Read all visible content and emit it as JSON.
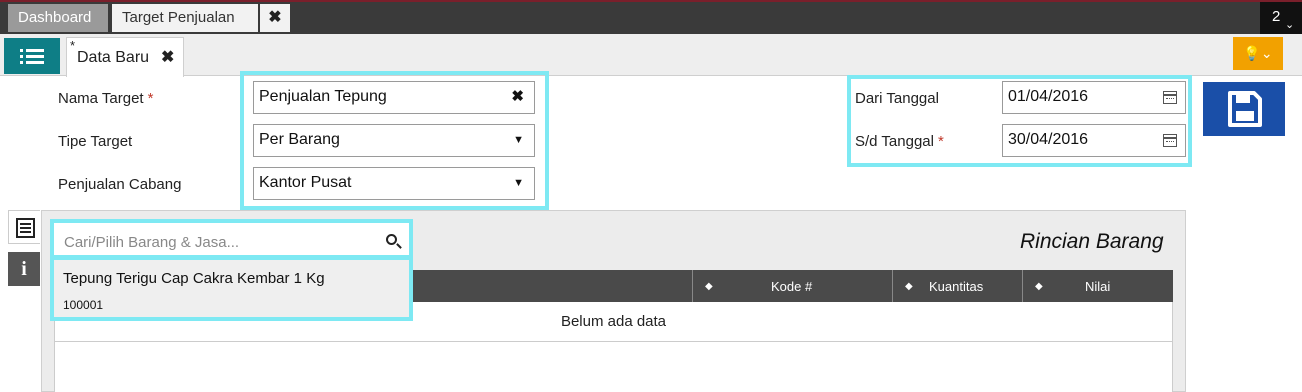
{
  "tabs": {
    "dashboard": "Dashboard",
    "target_penjualan": "Target Penjualan",
    "close": "✖",
    "count": "2",
    "count_chevron": "⌄"
  },
  "subbar": {
    "data_tab_star": "*",
    "data_tab_label": "Data Baru",
    "data_tab_close": "✖",
    "bulb": "💡⌄"
  },
  "form": {
    "nama_target_label": "Nama Target",
    "nama_target_value": "Penjualan Tepung",
    "tipe_target_label": "Tipe Target",
    "tipe_target_value": "Per Barang",
    "penjualan_cabang_label": "Penjualan Cabang",
    "penjualan_cabang_value": "Kantor Pusat",
    "dari_tanggal_label": "Dari Tanggal",
    "dari_tanggal_value": "01/04/2016",
    "sd_tanggal_label": "S/d Tanggal",
    "sd_tanggal_value": "30/04/2016",
    "required_mark": "*",
    "clear_icon": "✖",
    "caret_icon": "▼"
  },
  "side_tabs": {
    "info_label": "i"
  },
  "items": {
    "title": "Rincian Barang",
    "search_placeholder": "Cari/Pilih Barang & Jasa...",
    "columns": [
      "Kode #",
      "Kuantitas",
      "Nilai"
    ],
    "sort_icon": "◆",
    "empty": "Belum ada data",
    "suggestion": {
      "name": "Tepung Terigu Cap Cakra Kembar 1 Kg",
      "code": "100001"
    }
  },
  "colors": {
    "highlight": "#7ee9f3",
    "menu_button": "#0e7e86",
    "save_button": "#1a4fa8",
    "bulb_button": "#f2a100"
  }
}
